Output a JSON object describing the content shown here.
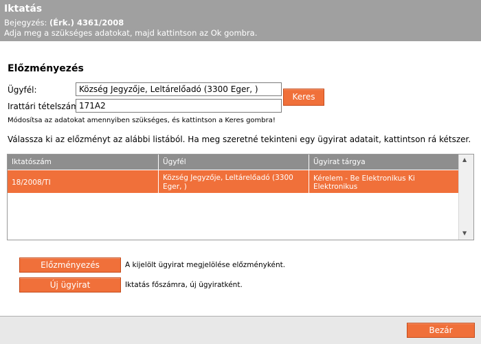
{
  "header": {
    "title": "Iktatás",
    "entry_label": "Bejegyzés:",
    "entry_value": "(Érk.) 4361/2008",
    "instruction": "Adja meg a szükséges adatokat, majd kattintson az Ok gombra."
  },
  "section": {
    "title": "Előzményezés"
  },
  "form": {
    "client_label": "Ügyfél:",
    "client_value": "Község Jegyzője, Leltárelőadó (3300 Eger, )",
    "item_label": "Irattári tételszám:",
    "item_value": "171A2",
    "search_button": "Keres",
    "hint": "Módosítsa az adatokat amennyiben szükséges, és kattintson a Keres gombra!"
  },
  "instructions": "Válassza ki az előzményt az alábbi listából. Ha meg szeretné tekinteni egy ügyirat adatait, kattintson rá kétszer.",
  "table": {
    "columns": [
      "Iktatószám",
      "Ügyfél",
      "Ügyirat tárgya"
    ],
    "rows": [
      {
        "number": "18/2008/TI",
        "client": "Község Jegyzője, Leltárelőadó (3300 Eger, )",
        "subject": "Kérelem - Be Elektronikus Ki Elektronikus"
      }
    ]
  },
  "actions": {
    "precedent_button": "Előzményezés",
    "precedent_desc": "A kijelölt ügyirat megjelölése előzményként.",
    "new_case_button": "Új ügyirat",
    "new_case_desc": "Iktatás főszámra, új ügyiratként."
  },
  "footer": {
    "close_button": "Bezár"
  },
  "colors": {
    "accent": "#f0703a",
    "header_bg": "#a0a0a0",
    "table_header_bg": "#8e8e8e"
  }
}
